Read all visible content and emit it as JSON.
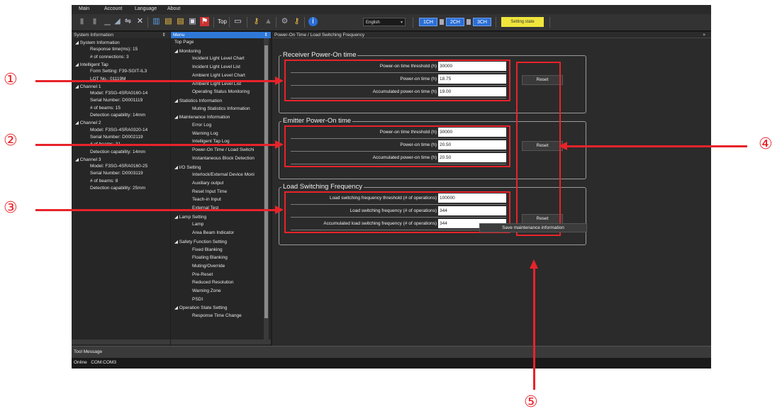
{
  "menubar": [
    "Main",
    "Account",
    "Language",
    "About"
  ],
  "toolbar": {
    "top_label": "Top",
    "language_value": "English",
    "channels": [
      "1CH",
      "2CH",
      "3CH"
    ],
    "setting_state_label": "Setting state"
  },
  "system_info": {
    "title": "System Information",
    "pin": "⇕",
    "lines": [
      {
        "text": "◢  System Information"
      },
      {
        "text": "Response time(ms): 15"
      },
      {
        "text": "# of connections: 3"
      },
      {
        "text": "◢  Intelligent Tap"
      },
      {
        "text": "Form Setting: F39-SGIT-IL3"
      },
      {
        "text": "LOT No.: 01119M"
      },
      {
        "text": "◢  Channel 1"
      },
      {
        "text": "Model: F3SG-4SRA0160-14"
      },
      {
        "text": "Serial Number: D0001119"
      },
      {
        "text": "# of beams: 15"
      },
      {
        "text": "Detection capability: 14mm"
      },
      {
        "text": "◢  Channel 2"
      },
      {
        "text": "Model: F3SG-4SRA0320-14"
      },
      {
        "text": "Serial Number: D0002119"
      },
      {
        "text": "# of beams: 31"
      },
      {
        "text": "Detection capability: 14mm"
      },
      {
        "text": "◢  Channel 3"
      },
      {
        "text": "Model: F3SG-4SRA0160-25"
      },
      {
        "text": "Serial Number: D0003119"
      },
      {
        "text": "# of beams: 8"
      },
      {
        "text": "Detection capability: 25mm"
      }
    ]
  },
  "menu": {
    "title": "Menu",
    "pin": "⇕",
    "items": [
      {
        "text": "Top Page"
      },
      {
        "text": "◢  Monitoring"
      },
      {
        "text": "Incident Light Level Chart"
      },
      {
        "text": "Incident Light Level List"
      },
      {
        "text": "Ambient Light Level Chart"
      },
      {
        "text": "Ambient Light Level List"
      },
      {
        "text": "Operating Status Monitoring"
      },
      {
        "text": "◢  Statistics Information"
      },
      {
        "text": "Muting Statistics Information"
      },
      {
        "text": "◢  Maintenance Information"
      },
      {
        "text": "Error Log"
      },
      {
        "text": "Warning Log"
      },
      {
        "text": "Intelligent Tap Log"
      },
      {
        "text": "Power-On Time / Load Switchi"
      },
      {
        "text": "Instantaneous Block Detection"
      },
      {
        "text": "◢  I/O Setting"
      },
      {
        "text": "Interlock/External Device Moni"
      },
      {
        "text": "Auxiliary output"
      },
      {
        "text": "Reset Input Time"
      },
      {
        "text": "Teach-in Input"
      },
      {
        "text": "External Test"
      },
      {
        "text": "◢  Lamp Setting"
      },
      {
        "text": "Lamp"
      },
      {
        "text": "Area Beam Indicator"
      },
      {
        "text": "◢  Safety Function Setting"
      },
      {
        "text": "Fixed Blanking"
      },
      {
        "text": "Floating Blanking"
      },
      {
        "text": "Muting/Override"
      },
      {
        "text": "Pre-Reset"
      },
      {
        "text": "Reduced Resolution"
      },
      {
        "text": "Warning Zone"
      },
      {
        "text": "PSDI"
      },
      {
        "text": "◢  Operation State Setting"
      },
      {
        "text": "Response Time Change"
      }
    ]
  },
  "main": {
    "title": "Power-On Time / Load Switching Frequency",
    "close": "×",
    "groups": [
      {
        "title": "Receiver Power-On time",
        "rows": [
          {
            "label": "Power-on time threshold (h)",
            "value": "30000"
          },
          {
            "label": "Power-on time (h)",
            "value": "18.75"
          },
          {
            "label": "Accumulated power-on time (h)",
            "value": "19.00"
          }
        ],
        "reset_label": "Reset"
      },
      {
        "title": "Emitter Power-On time",
        "rows": [
          {
            "label": "Power-on time threshold (h)",
            "value": "30000"
          },
          {
            "label": "Power-on time (h)",
            "value": "20.50"
          },
          {
            "label": "Accumulated power-on time (h)",
            "value": "20.50"
          }
        ],
        "reset_label": "Reset"
      },
      {
        "title": "Load Switching Frequency",
        "rows": [
          {
            "label": "Load switching frequency threshold (# of operations)",
            "value": "100000"
          },
          {
            "label": "Load switching frequency (# of operations)",
            "value": "344"
          },
          {
            "label": "Accumulated load switching frequency (# of operations)",
            "value": "344"
          }
        ],
        "reset_label": "Reset"
      }
    ],
    "save_label": "Save maintenance information"
  },
  "tool_message": "Tool Message",
  "status": "Online   COM:COM3",
  "callouts": [
    "①",
    "②",
    "③",
    "④",
    "⑤"
  ],
  "colors": {
    "callout_red": "#e8232a",
    "channel_blue": "#2b6fd6",
    "setting_yellow": "#f0e63c",
    "menu_header_blue": "#2f78d8"
  }
}
